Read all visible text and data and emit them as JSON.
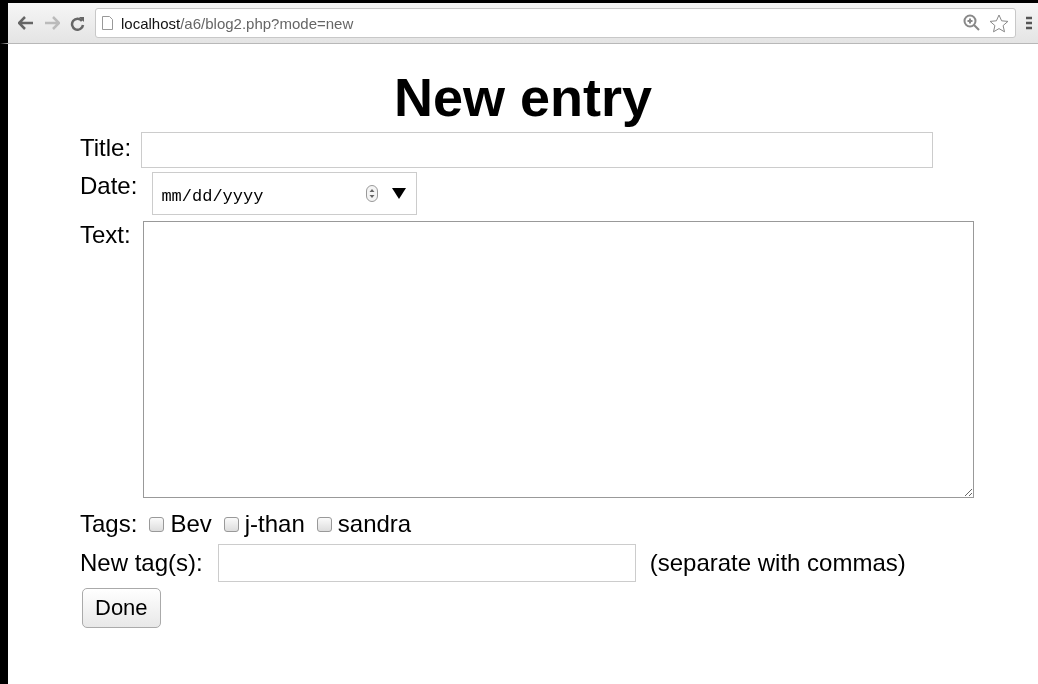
{
  "browser": {
    "url_host": "localhost",
    "url_path": "/a6/blog2.php?mode=new"
  },
  "heading": "New entry",
  "form": {
    "title_label": "Title:",
    "date_label": "Date:",
    "date_placeholder": "mm/dd/yyyy",
    "text_label": "Text:",
    "tags_label": "Tags:",
    "tags": [
      {
        "label": "Bev",
        "checked": false
      },
      {
        "label": "j-than",
        "checked": false
      },
      {
        "label": "sandra",
        "checked": false
      }
    ],
    "new_tags_label": "New tag(s):",
    "new_tags_hint": "(separate with commas)",
    "submit": "Done"
  }
}
